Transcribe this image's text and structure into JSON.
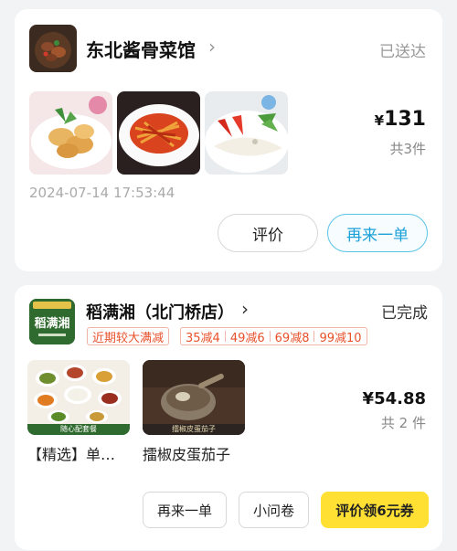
{
  "orders": [
    {
      "shop_name": "东北酱骨菜馆",
      "chevron_icon": "chevron-right-icon",
      "status": "已送达",
      "items": [
        {
          "image": "fried-pork-dish-image"
        },
        {
          "image": "shredded-pepper-dish-image"
        },
        {
          "image": "tofu-skin-salad-image"
        }
      ],
      "price_currency": "¥",
      "price_value": "131",
      "item_count": "共3件",
      "timestamp": "2024-07-14 17:53:44",
      "buttons": {
        "review": "评价",
        "reorder": "再来一单"
      }
    },
    {
      "shop_name": "稻满湘（北门桥店）",
      "shop_logo_text": "稻满湘",
      "chevron_icon": "chevron-right-icon",
      "status": "已完成",
      "promo_tag": "近期较大满减",
      "discounts": [
        "35减4",
        "49减6",
        "69减8",
        "99减10"
      ],
      "items": [
        {
          "name": "【精选】单…",
          "image": "combo-meal-image",
          "caption": "随心配套餐"
        },
        {
          "name": "擂椒皮蛋茄子",
          "image": "eggplant-dish-image",
          "caption": "擂椒皮蛋茄子"
        }
      ],
      "price_currency": "¥",
      "price_value": "54.88",
      "item_count": "共 2 件",
      "buttons": {
        "reorder": "再来一单",
        "survey": "小问卷",
        "review_coupon": "评价领6元券"
      }
    }
  ],
  "colors": {
    "accent_blue": "#1aa0d8",
    "promo_red": "#e8512b",
    "button_yellow": "#ffe033",
    "logo_green": "#2f6a2e"
  }
}
